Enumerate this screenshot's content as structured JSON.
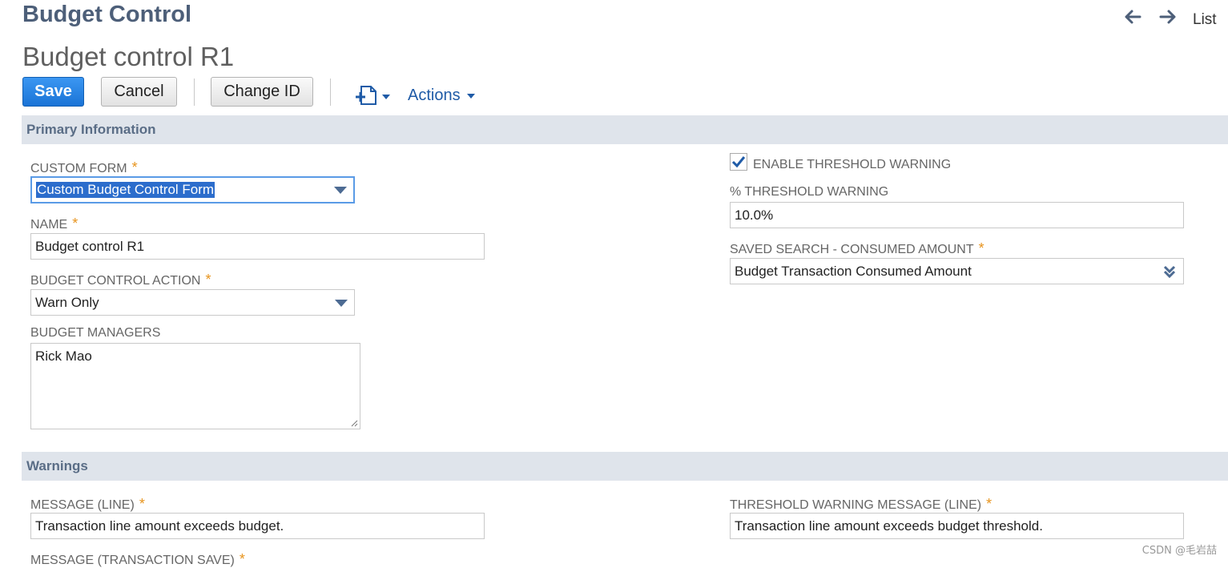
{
  "header": {
    "page_title": "Budget Control",
    "record_title": "Budget control R1",
    "nav_list_label": "List"
  },
  "toolbar": {
    "save_label": "Save",
    "cancel_label": "Cancel",
    "change_id_label": "Change ID",
    "actions_label": "Actions"
  },
  "sections": {
    "primary": "Primary Information",
    "warnings": "Warnings"
  },
  "primary": {
    "custom_form": {
      "label": "CUSTOM FORM",
      "value": "Custom Budget Control Form",
      "required": true
    },
    "name": {
      "label": "NAME",
      "value": "Budget control R1",
      "required": true
    },
    "budget_control_action": {
      "label": "BUDGET CONTROL ACTION",
      "value": "Warn Only",
      "required": true
    },
    "budget_managers": {
      "label": "BUDGET MANAGERS",
      "value": "Rick Mao"
    },
    "enable_threshold_warning": {
      "label": "ENABLE THRESHOLD WARNING",
      "checked": true
    },
    "threshold_warning_pct": {
      "label": "% THRESHOLD WARNING",
      "value": "10.0%"
    },
    "saved_search": {
      "label": "SAVED SEARCH - CONSUMED AMOUNT",
      "value": "Budget Transaction Consumed Amount",
      "required": true
    }
  },
  "warnings": {
    "message_line": {
      "label": "MESSAGE (LINE)",
      "value": "Transaction line amount exceeds budget.",
      "required": true
    },
    "threshold_message_line": {
      "label": "THRESHOLD WARNING MESSAGE (LINE)",
      "value": "Transaction line amount exceeds budget threshold.",
      "required": true
    },
    "message_transaction_save": {
      "label": "MESSAGE (TRANSACTION SAVE)",
      "required": true
    }
  },
  "required_mark": "*",
  "watermark": "CSDN @毛岩喆",
  "colors": {
    "accent_blue": "#1a73d6",
    "section_bg": "#dfe4eb",
    "required": "#e7941d",
    "title": "#4d5f79"
  },
  "icons": [
    "arrow-left-icon",
    "arrow-right-icon",
    "new-record-icon",
    "dropdown-caret-icon",
    "checkmark-icon",
    "double-chevron-down-icon",
    "resize-grip-icon"
  ]
}
